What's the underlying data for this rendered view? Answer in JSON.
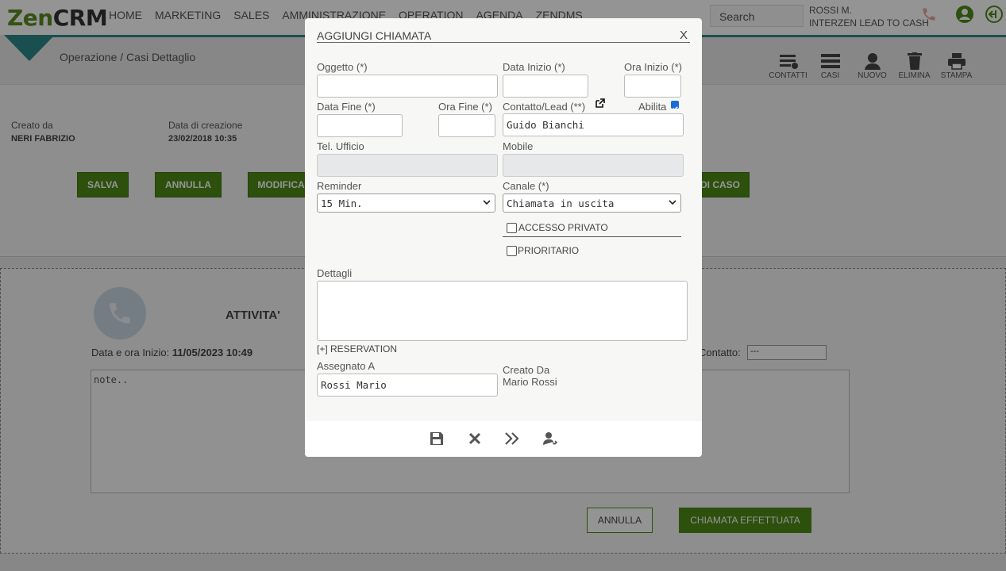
{
  "app": {
    "logo_zen": "Zen",
    "logo_crm": "CRM",
    "nav": [
      "HOME",
      "MARKETING",
      "SALES",
      "AMMINISTRAZIONE",
      "OPERATION",
      "AGENDA",
      "ZENDMS"
    ],
    "search_label": "Search",
    "user_name": "ROSSI M.",
    "user_company": "INTERZEN LEAD TO CASH",
    "accent": "#4e8a18",
    "teal": "#2b8a88"
  },
  "page": {
    "breadcrumb": "Operazione / Casi Dettaglio",
    "toolbar": [
      "CONTATTI",
      "CASI",
      "NUOVO",
      "ELIMINA",
      "STAMPA"
    ],
    "creato_da_label": "Creato da",
    "creato_da_value": "NERI FABRIZIO",
    "data_creazione_label": "Data di creazione",
    "data_creazione_value": "23/02/2018 10:35",
    "buttons": {
      "salva": "SALVA",
      "annulla": "ANNULLA",
      "modifica": "MODIFICA",
      "caso": "DI CASO"
    }
  },
  "activity": {
    "title": "ATTIVITA'",
    "data_ora_label": "Data e ora Inizio:",
    "data_ora_value": "11/05/2023  10:49",
    "contatto_label": "Contatto:",
    "contatto_value": "---",
    "note": "note..",
    "annulla": "ANNULLA",
    "effettuata": "CHIAMATA EFFETTUATA"
  },
  "modal": {
    "title": "AGGIUNGI CHIAMATA",
    "close": "X",
    "oggetto_label": "Oggetto (*)",
    "oggetto_value": "",
    "data_inizio_label": "Data Inizio (*)",
    "ora_inizio_label": "Ora Inizio (*)",
    "data_fine_label": "Data Fine (*)",
    "ora_fine_label": "Ora Fine (*)",
    "contatto_label": "Contatto/Lead (**)",
    "abilita_label": "Abilita",
    "abilita_checked": true,
    "contatto_value": "Guido Bianchi",
    "tel_ufficio_label": "Tel. Ufficio",
    "mobile_label": "Mobile",
    "reminder_label": "Reminder",
    "reminder_value": "15 Min.",
    "canale_label": "Canale (*)",
    "canale_value": "Chiamata in uscita",
    "accesso_privato_label": "ACCESSO PRIVATO",
    "prioritario_label": "PRIORITARIO",
    "dettagli_label": "Dettagli",
    "reservation_label": "[+] RESERVATION",
    "assegnato_label": "Assegnato A",
    "assegnato_value": "Rossi Mario",
    "creato_da_label": "Creato Da",
    "creato_da_value": "Mario Rossi",
    "footer_icons": [
      "save-icon",
      "close-icon",
      "forward-icon",
      "assign-user-icon"
    ]
  }
}
